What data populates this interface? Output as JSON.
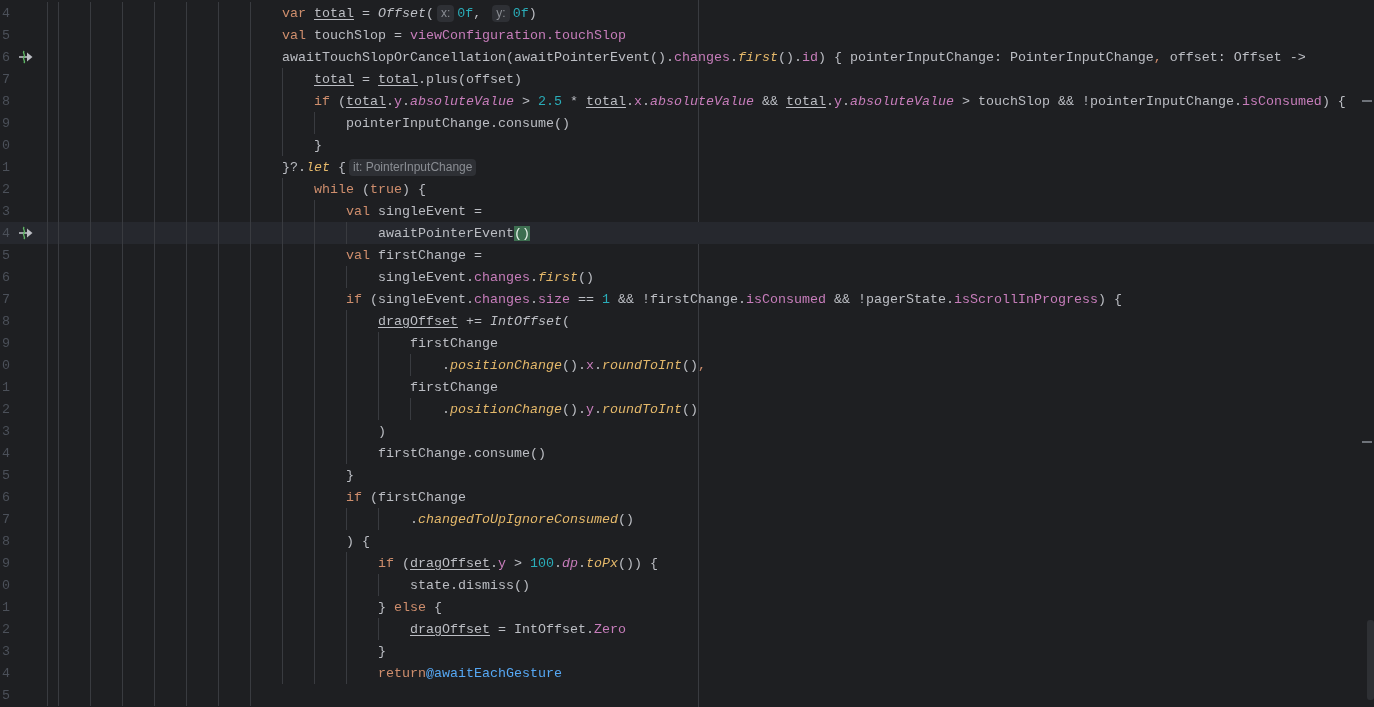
{
  "editor": {
    "lines": [
      {
        "number": "4",
        "current": false,
        "suspend_call": false,
        "tokens": [
          {
            "text": "var ",
            "kind": "keyword"
          },
          {
            "text": "total",
            "kind": "variable"
          },
          {
            "text": " = ",
            "kind": "plain"
          },
          {
            "text": "Offset",
            "kind": "type"
          },
          {
            "text": "(",
            "kind": "plain"
          },
          {
            "text": "x:",
            "kind": "hint"
          },
          {
            "text": "0f",
            "kind": "number"
          },
          {
            "text": ", ",
            "kind": "plain"
          },
          {
            "text": "y:",
            "kind": "hint"
          },
          {
            "text": "0f",
            "kind": "number"
          },
          {
            "text": ")",
            "kind": "plain"
          }
        ]
      },
      {
        "number": "5",
        "current": false,
        "suspend_call": false,
        "tokens": [
          {
            "text": "val",
            "kind": "keyword"
          },
          {
            "text": " touchSlop = ",
            "kind": "plain"
          },
          {
            "text": "viewConfiguration.touchSlop",
            "kind": "property"
          }
        ]
      },
      {
        "number": "6",
        "current": false,
        "suspend_call": true,
        "tokens": [
          {
            "text": "awaitTouchSlopOrCancellation(awaitPointerEvent().",
            "kind": "plain"
          },
          {
            "text": "changes",
            "kind": "property"
          },
          {
            "text": ".",
            "kind": "plain"
          },
          {
            "text": "first",
            "kind": "function"
          },
          {
            "text": "().",
            "kind": "plain"
          },
          {
            "text": "id",
            "kind": "property"
          },
          {
            "text": ") { pointerInputChange: PointerInputChange",
            "kind": "plain"
          },
          {
            "text": ",",
            "kind": "keyword"
          },
          {
            "text": " offset: Offset ->",
            "kind": "plain"
          }
        ]
      },
      {
        "number": "7",
        "current": false,
        "suspend_call": false,
        "tokens": [
          {
            "text": "    total",
            "kind": "variable"
          },
          {
            "text": " = ",
            "kind": "plain"
          },
          {
            "text": "total",
            "kind": "variable"
          },
          {
            "text": ".plus(offset)",
            "kind": "plain"
          }
        ]
      },
      {
        "number": "8",
        "current": false,
        "suspend_call": false,
        "tokens": [
          {
            "text": "    if",
            "kind": "keyword"
          },
          {
            "text": " (",
            "kind": "plain"
          },
          {
            "text": "total",
            "kind": "variable"
          },
          {
            "text": ".",
            "kind": "plain"
          },
          {
            "text": "y",
            "kind": "property"
          },
          {
            "text": ".",
            "kind": "plain"
          },
          {
            "text": "absoluteValue",
            "kind": "extension"
          },
          {
            "text": " > ",
            "kind": "plain"
          },
          {
            "text": "2.5",
            "kind": "number"
          },
          {
            "text": " * ",
            "kind": "plain"
          },
          {
            "text": "total",
            "kind": "variable"
          },
          {
            "text": ".",
            "kind": "plain"
          },
          {
            "text": "x",
            "kind": "property"
          },
          {
            "text": ".",
            "kind": "plain"
          },
          {
            "text": "absoluteValue",
            "kind": "extension"
          },
          {
            "text": " && ",
            "kind": "plain"
          },
          {
            "text": "total",
            "kind": "variable"
          },
          {
            "text": ".",
            "kind": "plain"
          },
          {
            "text": "y",
            "kind": "property"
          },
          {
            "text": ".",
            "kind": "plain"
          },
          {
            "text": "absoluteValue",
            "kind": "extension"
          },
          {
            "text": " > touchSlop && !pointerInputChange.",
            "kind": "plain"
          },
          {
            "text": "isConsumed",
            "kind": "property"
          },
          {
            "text": ") {",
            "kind": "plain"
          }
        ]
      },
      {
        "number": "9",
        "current": false,
        "suspend_call": false,
        "tokens": [
          {
            "text": "        pointerInputChange.consume()",
            "kind": "plain"
          }
        ]
      },
      {
        "number": "0",
        "current": false,
        "suspend_call": false,
        "tokens": [
          {
            "text": "    }",
            "kind": "plain"
          }
        ]
      },
      {
        "number": "1",
        "current": false,
        "suspend_call": false,
        "tokens": [
          {
            "text": "}?.",
            "kind": "plain"
          },
          {
            "text": "let",
            "kind": "function"
          },
          {
            "text": " {",
            "kind": "plain"
          },
          {
            "text": "it: PointerInputChange",
            "kind": "hint"
          }
        ]
      },
      {
        "number": "2",
        "current": false,
        "suspend_call": false,
        "tokens": [
          {
            "text": "    while",
            "kind": "keyword"
          },
          {
            "text": " (",
            "kind": "plain"
          },
          {
            "text": "true",
            "kind": "keyword"
          },
          {
            "text": ") {",
            "kind": "plain"
          }
        ]
      },
      {
        "number": "3",
        "current": false,
        "suspend_call": false,
        "tokens": [
          {
            "text": "        val",
            "kind": "keyword"
          },
          {
            "text": " singleEvent =",
            "kind": "plain"
          }
        ]
      },
      {
        "number": "4",
        "current": true,
        "suspend_call": true,
        "tokens": [
          {
            "text": "            awaitPointerEvent",
            "kind": "plain"
          },
          {
            "text": "()",
            "kind": "brace_match"
          }
        ]
      },
      {
        "number": "5",
        "current": false,
        "suspend_call": false,
        "tokens": [
          {
            "text": "        val",
            "kind": "keyword"
          },
          {
            "text": " firstChange =",
            "kind": "plain"
          }
        ]
      },
      {
        "number": "6",
        "current": false,
        "suspend_call": false,
        "tokens": [
          {
            "text": "            singleEvent.",
            "kind": "plain"
          },
          {
            "text": "changes",
            "kind": "property"
          },
          {
            "text": ".",
            "kind": "plain"
          },
          {
            "text": "first",
            "kind": "function"
          },
          {
            "text": "()",
            "kind": "plain"
          }
        ]
      },
      {
        "number": "7",
        "current": false,
        "suspend_call": false,
        "tokens": [
          {
            "text": "        if",
            "kind": "keyword"
          },
          {
            "text": " (singleEvent.",
            "kind": "plain"
          },
          {
            "text": "changes",
            "kind": "property"
          },
          {
            "text": ".",
            "kind": "plain"
          },
          {
            "text": "size",
            "kind": "property"
          },
          {
            "text": " == ",
            "kind": "plain"
          },
          {
            "text": "1",
            "kind": "number"
          },
          {
            "text": " && !firstChange.",
            "kind": "plain"
          },
          {
            "text": "isConsumed",
            "kind": "property"
          },
          {
            "text": " && !pagerState.",
            "kind": "plain"
          },
          {
            "text": "isScrollInProgress",
            "kind": "property"
          },
          {
            "text": ") {",
            "kind": "plain"
          }
        ]
      },
      {
        "number": "8",
        "current": false,
        "suspend_call": false,
        "tokens": [
          {
            "text": "            dragOffset",
            "kind": "variable"
          },
          {
            "text": " += ",
            "kind": "plain"
          },
          {
            "text": "IntOffset",
            "kind": "type"
          },
          {
            "text": "(",
            "kind": "plain"
          }
        ]
      },
      {
        "number": "9",
        "current": false,
        "suspend_call": false,
        "tokens": [
          {
            "text": "                firstChange",
            "kind": "plain"
          }
        ]
      },
      {
        "number": "0",
        "current": false,
        "suspend_call": false,
        "tokens": [
          {
            "text": "                    .",
            "kind": "plain"
          },
          {
            "text": "positionChange",
            "kind": "function"
          },
          {
            "text": "().",
            "kind": "plain"
          },
          {
            "text": "x",
            "kind": "property"
          },
          {
            "text": ".",
            "kind": "plain"
          },
          {
            "text": "roundToInt",
            "kind": "function"
          },
          {
            "text": "()",
            "kind": "plain"
          },
          {
            "text": ",",
            "kind": "keyword"
          }
        ]
      },
      {
        "number": "1",
        "current": false,
        "suspend_call": false,
        "tokens": [
          {
            "text": "                firstChange",
            "kind": "plain"
          }
        ]
      },
      {
        "number": "2",
        "current": false,
        "suspend_call": false,
        "tokens": [
          {
            "text": "                    .",
            "kind": "plain"
          },
          {
            "text": "positionChange",
            "kind": "function"
          },
          {
            "text": "().",
            "kind": "plain"
          },
          {
            "text": "y",
            "kind": "property"
          },
          {
            "text": ".",
            "kind": "plain"
          },
          {
            "text": "roundToInt",
            "kind": "function"
          },
          {
            "text": "()",
            "kind": "plain"
          }
        ]
      },
      {
        "number": "3",
        "current": false,
        "suspend_call": false,
        "tokens": [
          {
            "text": "            )",
            "kind": "plain"
          }
        ]
      },
      {
        "number": "4",
        "current": false,
        "suspend_call": false,
        "tokens": [
          {
            "text": "            firstChange.consume()",
            "kind": "plain"
          }
        ]
      },
      {
        "number": "5",
        "current": false,
        "suspend_call": false,
        "tokens": [
          {
            "text": "        }",
            "kind": "plain"
          }
        ]
      },
      {
        "number": "6",
        "current": false,
        "suspend_call": false,
        "tokens": [
          {
            "text": "        if",
            "kind": "keyword"
          },
          {
            "text": " (firstChange",
            "kind": "plain"
          }
        ]
      },
      {
        "number": "7",
        "current": false,
        "suspend_call": false,
        "tokens": [
          {
            "text": "                .",
            "kind": "plain"
          },
          {
            "text": "changedToUpIgnoreConsumed",
            "kind": "function"
          },
          {
            "text": "()",
            "kind": "plain"
          }
        ]
      },
      {
        "number": "8",
        "current": false,
        "suspend_call": false,
        "tokens": [
          {
            "text": "        ) {",
            "kind": "plain"
          }
        ]
      },
      {
        "number": "9",
        "current": false,
        "suspend_call": false,
        "tokens": [
          {
            "text": "            if",
            "kind": "keyword"
          },
          {
            "text": " (",
            "kind": "plain"
          },
          {
            "text": "dragOffset",
            "kind": "variable"
          },
          {
            "text": ".",
            "kind": "plain"
          },
          {
            "text": "y",
            "kind": "property"
          },
          {
            "text": " > ",
            "kind": "plain"
          },
          {
            "text": "100",
            "kind": "number"
          },
          {
            "text": ".",
            "kind": "plain"
          },
          {
            "text": "dp",
            "kind": "extension"
          },
          {
            "text": ".",
            "kind": "plain"
          },
          {
            "text": "toPx",
            "kind": "function"
          },
          {
            "text": "()) {",
            "kind": "plain"
          }
        ]
      },
      {
        "number": "0",
        "current": false,
        "suspend_call": false,
        "tokens": [
          {
            "text": "                state.dismiss()",
            "kind": "plain"
          }
        ]
      },
      {
        "number": "1",
        "current": false,
        "suspend_call": false,
        "tokens": [
          {
            "text": "            }",
            "kind": "plain"
          },
          {
            "text": " else",
            "kind": "keyword"
          },
          {
            "text": " {",
            "kind": "plain"
          }
        ]
      },
      {
        "number": "2",
        "current": false,
        "suspend_call": false,
        "tokens": [
          {
            "text": "                dragOffset",
            "kind": "variable"
          },
          {
            "text": " = IntOffset.",
            "kind": "plain"
          },
          {
            "text": "Zero",
            "kind": "property"
          }
        ]
      },
      {
        "number": "3",
        "current": false,
        "suspend_call": false,
        "tokens": [
          {
            "text": "            }",
            "kind": "plain"
          }
        ]
      },
      {
        "number": "4",
        "current": false,
        "suspend_call": false,
        "tokens": [
          {
            "text": "            return",
            "kind": "keyword"
          },
          {
            "text": "@awaitEachGesture",
            "kind": "label"
          }
        ]
      },
      {
        "number": "5",
        "current": false,
        "suspend_call": false
      }
    ]
  }
}
